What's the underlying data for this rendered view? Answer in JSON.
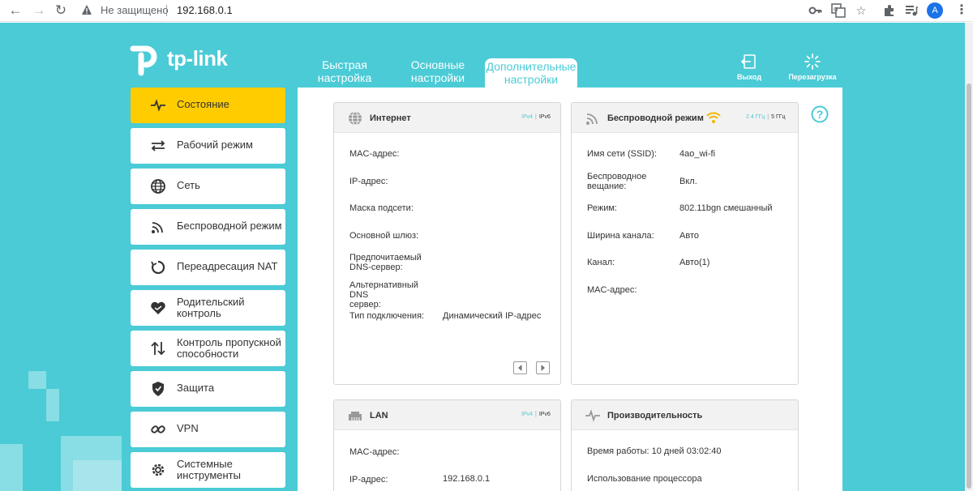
{
  "browser": {
    "security_label": "Не защищено",
    "url": "192.168.0.1",
    "avatar_letter": "A",
    "icons": [
      "back-arrow-icon",
      "forward-arrow-icon",
      "reload-icon",
      "warning-icon",
      "key-icon",
      "translate-icon",
      "star-icon",
      "extensions-icon",
      "media-icon",
      "menu-icon"
    ]
  },
  "logo": {
    "text": "tp-link"
  },
  "top_tabs": [
    {
      "label_line1": "Быстрая",
      "label_line2": "настройка"
    },
    {
      "label_line1": "Основные",
      "label_line2": "настройки"
    },
    {
      "label_line1": "Дополнительные",
      "label_line2": "настройки"
    }
  ],
  "top_actions": {
    "logout": "Выход",
    "reboot": "Перезагрузка"
  },
  "sidebar": {
    "items": [
      {
        "label": "Состояние",
        "icon": "pulse-icon"
      },
      {
        "label": "Рабочий режим",
        "icon": "switch-mode-icon"
      },
      {
        "label": "Сеть",
        "icon": "globe-icon"
      },
      {
        "label": "Беспроводной режим",
        "icon": "wifi-icon"
      },
      {
        "label": "Переадресация NAT",
        "icon": "nat-forwarding-icon"
      },
      {
        "label1": "Родительский",
        "label2": "контроль",
        "icon": "parental-control-icon"
      },
      {
        "label1": "Контроль пропускной",
        "label2": "способности",
        "icon": "bandwidth-icon"
      },
      {
        "label": "Защита",
        "icon": "shield-icon"
      },
      {
        "label": "VPN",
        "icon": "vpn-key-icon"
      },
      {
        "label1": "Системные",
        "label2": "инструменты",
        "icon": "system-tools-icon"
      }
    ]
  },
  "cards": {
    "internet": {
      "title": "Интернет",
      "proto_ipv4": "IPv4",
      "proto_ipv6": "IPv6",
      "rows": [
        {
          "label": "MAC-адрес:",
          "value": ""
        },
        {
          "label": "IP-адрес:",
          "value": ""
        },
        {
          "label": "Маска подсети:",
          "value": ""
        },
        {
          "label": "Основной шлюз:",
          "value": ""
        },
        {
          "label1": "Предпочитаемый",
          "label2": "DNS-сервер:",
          "value": ""
        },
        {
          "label1": "Альтернативный DNS",
          "label2": "сервер:",
          "value": ""
        },
        {
          "label": "Тип подключения:",
          "value": "Динамический IP-адрес"
        }
      ]
    },
    "wireless": {
      "title": "Беспроводной режим",
      "band_24": "2.4 ГГц",
      "band_5": "5 ГГц",
      "rows": [
        {
          "label": "Имя сети (SSID):",
          "value": "4ao_wi-fi"
        },
        {
          "label1": "Беспроводное",
          "label2": "вещание:",
          "value": "Вкл."
        },
        {
          "label": "Режим:",
          "value": "802.11bgn смешанный"
        },
        {
          "label": "Ширина канала:",
          "value": "Авто"
        },
        {
          "label": "Канал:",
          "value": "Авто(1)"
        },
        {
          "label": "MAC-адрес:",
          "value": ""
        }
      ]
    },
    "lan": {
      "title": "LAN",
      "proto_ipv4": "IPv4",
      "proto_ipv6": "IPv6",
      "rows": [
        {
          "label": "MAC-адрес:",
          "value": ""
        },
        {
          "label": "IP-адрес:",
          "value": "192.168.0.1"
        }
      ]
    },
    "performance": {
      "title": "Производительность",
      "uptime": "Время работы: 10 дней 03:02:40",
      "cpu": "Использование процессора"
    }
  },
  "colors": {
    "teal": "#4acbd6",
    "yellow": "#ffcc00"
  }
}
